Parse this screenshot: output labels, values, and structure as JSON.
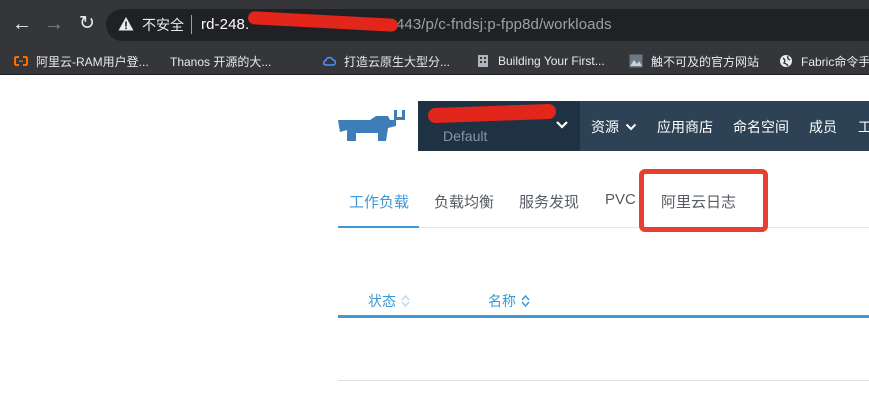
{
  "browser": {
    "security_label": "不安全",
    "url_host": "rd-248.",
    "url_rest": ":8443/p/c-fndsj:p-fpp8d/workloads",
    "bookmarks": [
      {
        "label": "阿里云-RAM用户登...",
        "icon": "aliyun-icon"
      },
      {
        "label": "Thanos 开源的大...",
        "icon": "thanos-icon"
      },
      {
        "label": "打造云原生大型分...",
        "icon": "cloud-icon"
      },
      {
        "label": "Building Your First...",
        "icon": "building-icon"
      },
      {
        "label": "触不可及的官方网站",
        "icon": "image-icon"
      },
      {
        "label": "Fabric命令手",
        "icon": "globe-icon"
      }
    ]
  },
  "header": {
    "project_name": "Default",
    "nav": {
      "resources": "资源",
      "app_store": "应用商店",
      "namespaces": "命名空间",
      "members": "成员",
      "tools": "工"
    }
  },
  "tabs": [
    {
      "label": "工作负载",
      "active": true
    },
    {
      "label": "负载均衡",
      "active": false
    },
    {
      "label": "服务发现",
      "active": false
    },
    {
      "label": "PVC",
      "active": false
    },
    {
      "label": "阿里云日志",
      "active": false
    }
  ],
  "table": {
    "columns": [
      "状态",
      "名称"
    ]
  },
  "colors": {
    "accent": "#3d98d3",
    "header_bg": "#2d4254",
    "highlight": "#e93f2f"
  }
}
